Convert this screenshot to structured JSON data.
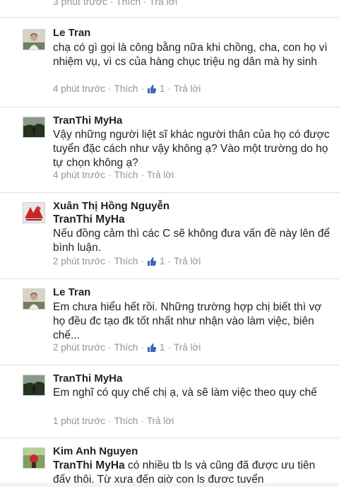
{
  "top_meta": "3 phút trước · Thích · Trả lời",
  "labels": {
    "like": "Thích",
    "reply": "Trả lời",
    "dot": "·"
  },
  "comments": [
    {
      "author": "Le Tran",
      "text": "chạ có gì gọi là công bằng nữa khi chồng, cha, con họ vì nhiệm vụ, vì cs của hàng chục triệu ng dân mà hy sinh",
      "time": "4 phút trước",
      "likes": "1"
    },
    {
      "author": "TranThi MyHa",
      "text": "Vậy những người liệt sĩ khác người thân của họ có được tuyển đặc cách như vậy không ạ? Vào một trường do họ tự chọn không ạ?",
      "time": "4 phút trước",
      "likes": ""
    },
    {
      "author": "Xuân Thị Hồng Nguyễn",
      "reply_to": "TranThi MyHa",
      "text": "Nếu đồng cảm thì các C sẽ không đưa vấn đề này lên để bình luận.",
      "time": "2 phút trước",
      "likes": "1"
    },
    {
      "author": "Le Tran",
      "text": "Em chưa hiểu hết rồi. Những trường hợp chị biết thì vợ họ đều đc tạo đk tốt nhất như nhận vào làm việc, biên chế...",
      "time": "2 phút trước",
      "likes": "1"
    },
    {
      "author": "TranThi MyHa",
      "text": "Em nghĩ có quy chế chị ạ, và sẽ làm việc theo quy chế",
      "time": "1 phút trước",
      "likes": ""
    },
    {
      "author": "Kim Anh Nguyen",
      "reply_to": "TranThi MyHa",
      "text": "có nhiều tb ls và cũng đã được ưu tiên đấy thôi. Từ xưa đến giờ con ls được tuyển",
      "time": "",
      "likes": ""
    }
  ],
  "colors": {
    "text": "#1d2129",
    "meta": "#90949c",
    "like_blue": "#4267b2",
    "divider": "#dddfe2"
  }
}
